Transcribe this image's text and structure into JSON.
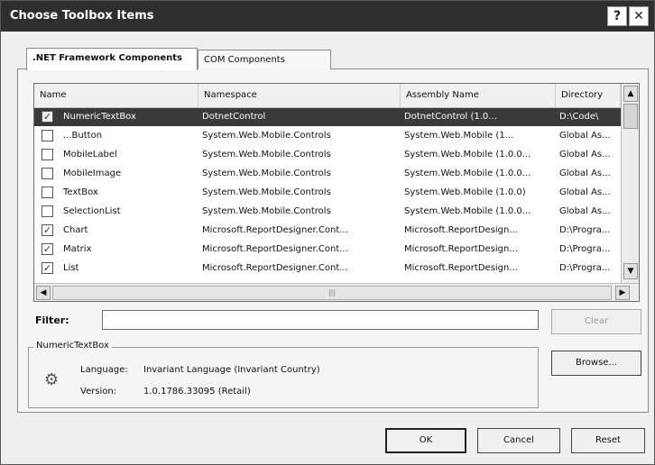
{
  "window": {
    "title": "Choose Toolbox Items",
    "help_glyph": "?",
    "close_glyph": "✕"
  },
  "tabs": [
    {
      "label": ".NET Framework Components",
      "active": true
    },
    {
      "label": "COM Components",
      "active": false
    }
  ],
  "grid": {
    "headers": [
      "Name",
      "Namespace",
      "Assembly Name",
      "Directory"
    ],
    "rows": [
      {
        "checked": true,
        "name": "NumericTextBox",
        "namespace": "DotnetControl",
        "assembly": "DotnetControl (1.0...",
        "directory": "D:\\Code\\",
        "selected": true
      },
      {
        "checked": false,
        "name": "  ...Button",
        "namespace": "System.Web.Mobile.Controls",
        "assembly": "System.Web.Mobile (1...",
        "directory": "Global As...",
        "selected": false
      },
      {
        "checked": false,
        "name": "MobileLabel",
        "namespace": "System.Web.Mobile.Controls",
        "assembly": "System.Web.Mobile (1.0.0...",
        "directory": "Global As...",
        "selected": false
      },
      {
        "checked": false,
        "name": "MobileImage",
        "namespace": "System.Web.Mobile.Controls",
        "assembly": "System.Web.Mobile (1.0.0...",
        "directory": "Global As...",
        "selected": false
      },
      {
        "checked": false,
        "name": "TextBox",
        "namespace": "System.Web.Mobile.Controls",
        "assembly": "System.Web.Mobile (1.0.0)",
        "directory": "Global As...",
        "selected": false
      },
      {
        "checked": false,
        "name": "SelectionList",
        "namespace": "System.Web.Mobile.Controls",
        "assembly": "System.Web.Mobile (1.0.0...",
        "directory": "Global As...",
        "selected": false
      },
      {
        "checked": true,
        "name": "Chart",
        "namespace": "Microsoft.ReportDesigner.Cont...",
        "assembly": "Microsoft.ReportDesign...",
        "directory": "D:\\Progra...",
        "selected": false
      },
      {
        "checked": true,
        "name": "Matrix",
        "namespace": "Microsoft.ReportDesigner.Cont...",
        "assembly": "Microsoft.ReportDesign...",
        "directory": "D:\\Progra...",
        "selected": false
      },
      {
        "checked": true,
        "name": "List",
        "namespace": "Microsoft.ReportDesigner.Cont...",
        "assembly": "Microsoft.ReportDesign...",
        "directory": "D:\\Progra...",
        "selected": false
      }
    ],
    "vscroll_up": "▲",
    "vscroll_down": "▼",
    "hscroll_left": "◀",
    "hscroll_right": "▶",
    "hscroll_grip": "|||"
  },
  "filter": {
    "label": "Filter:",
    "value": "",
    "clear_label": "Clear"
  },
  "info": {
    "group_label": "NumericTextBox",
    "language_label": "Language:",
    "language_value": "Invariant Language (Invariant Country)",
    "version_label": "Version:",
    "version_value": "1.0.1786.33095 (Retail)",
    "icon_glyph": "⚙"
  },
  "buttons": {
    "browse": "Browse...",
    "ok": "OK",
    "cancel": "Cancel",
    "reset": "Reset"
  }
}
